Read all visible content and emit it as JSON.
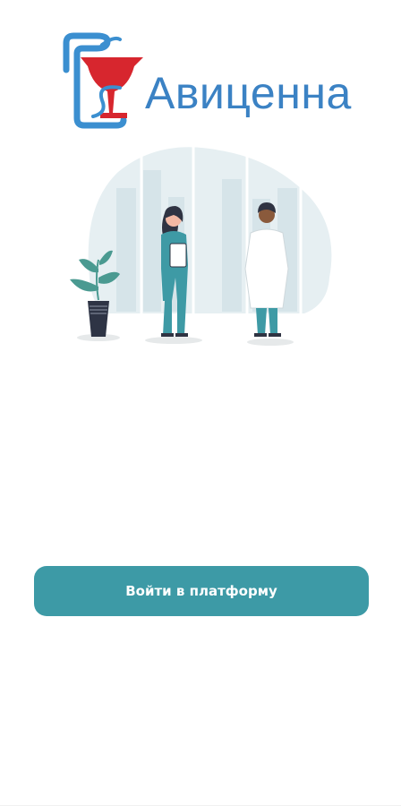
{
  "app": {
    "name": "Авиценна"
  },
  "colors": {
    "brand_blue": "#3b82c4",
    "brand_red": "#d7262e",
    "accent_teal": "#3d9aa6"
  },
  "illustration": {
    "icon": "medical-staff-illustration"
  },
  "actions": {
    "login_label": "Войти в платформу"
  }
}
